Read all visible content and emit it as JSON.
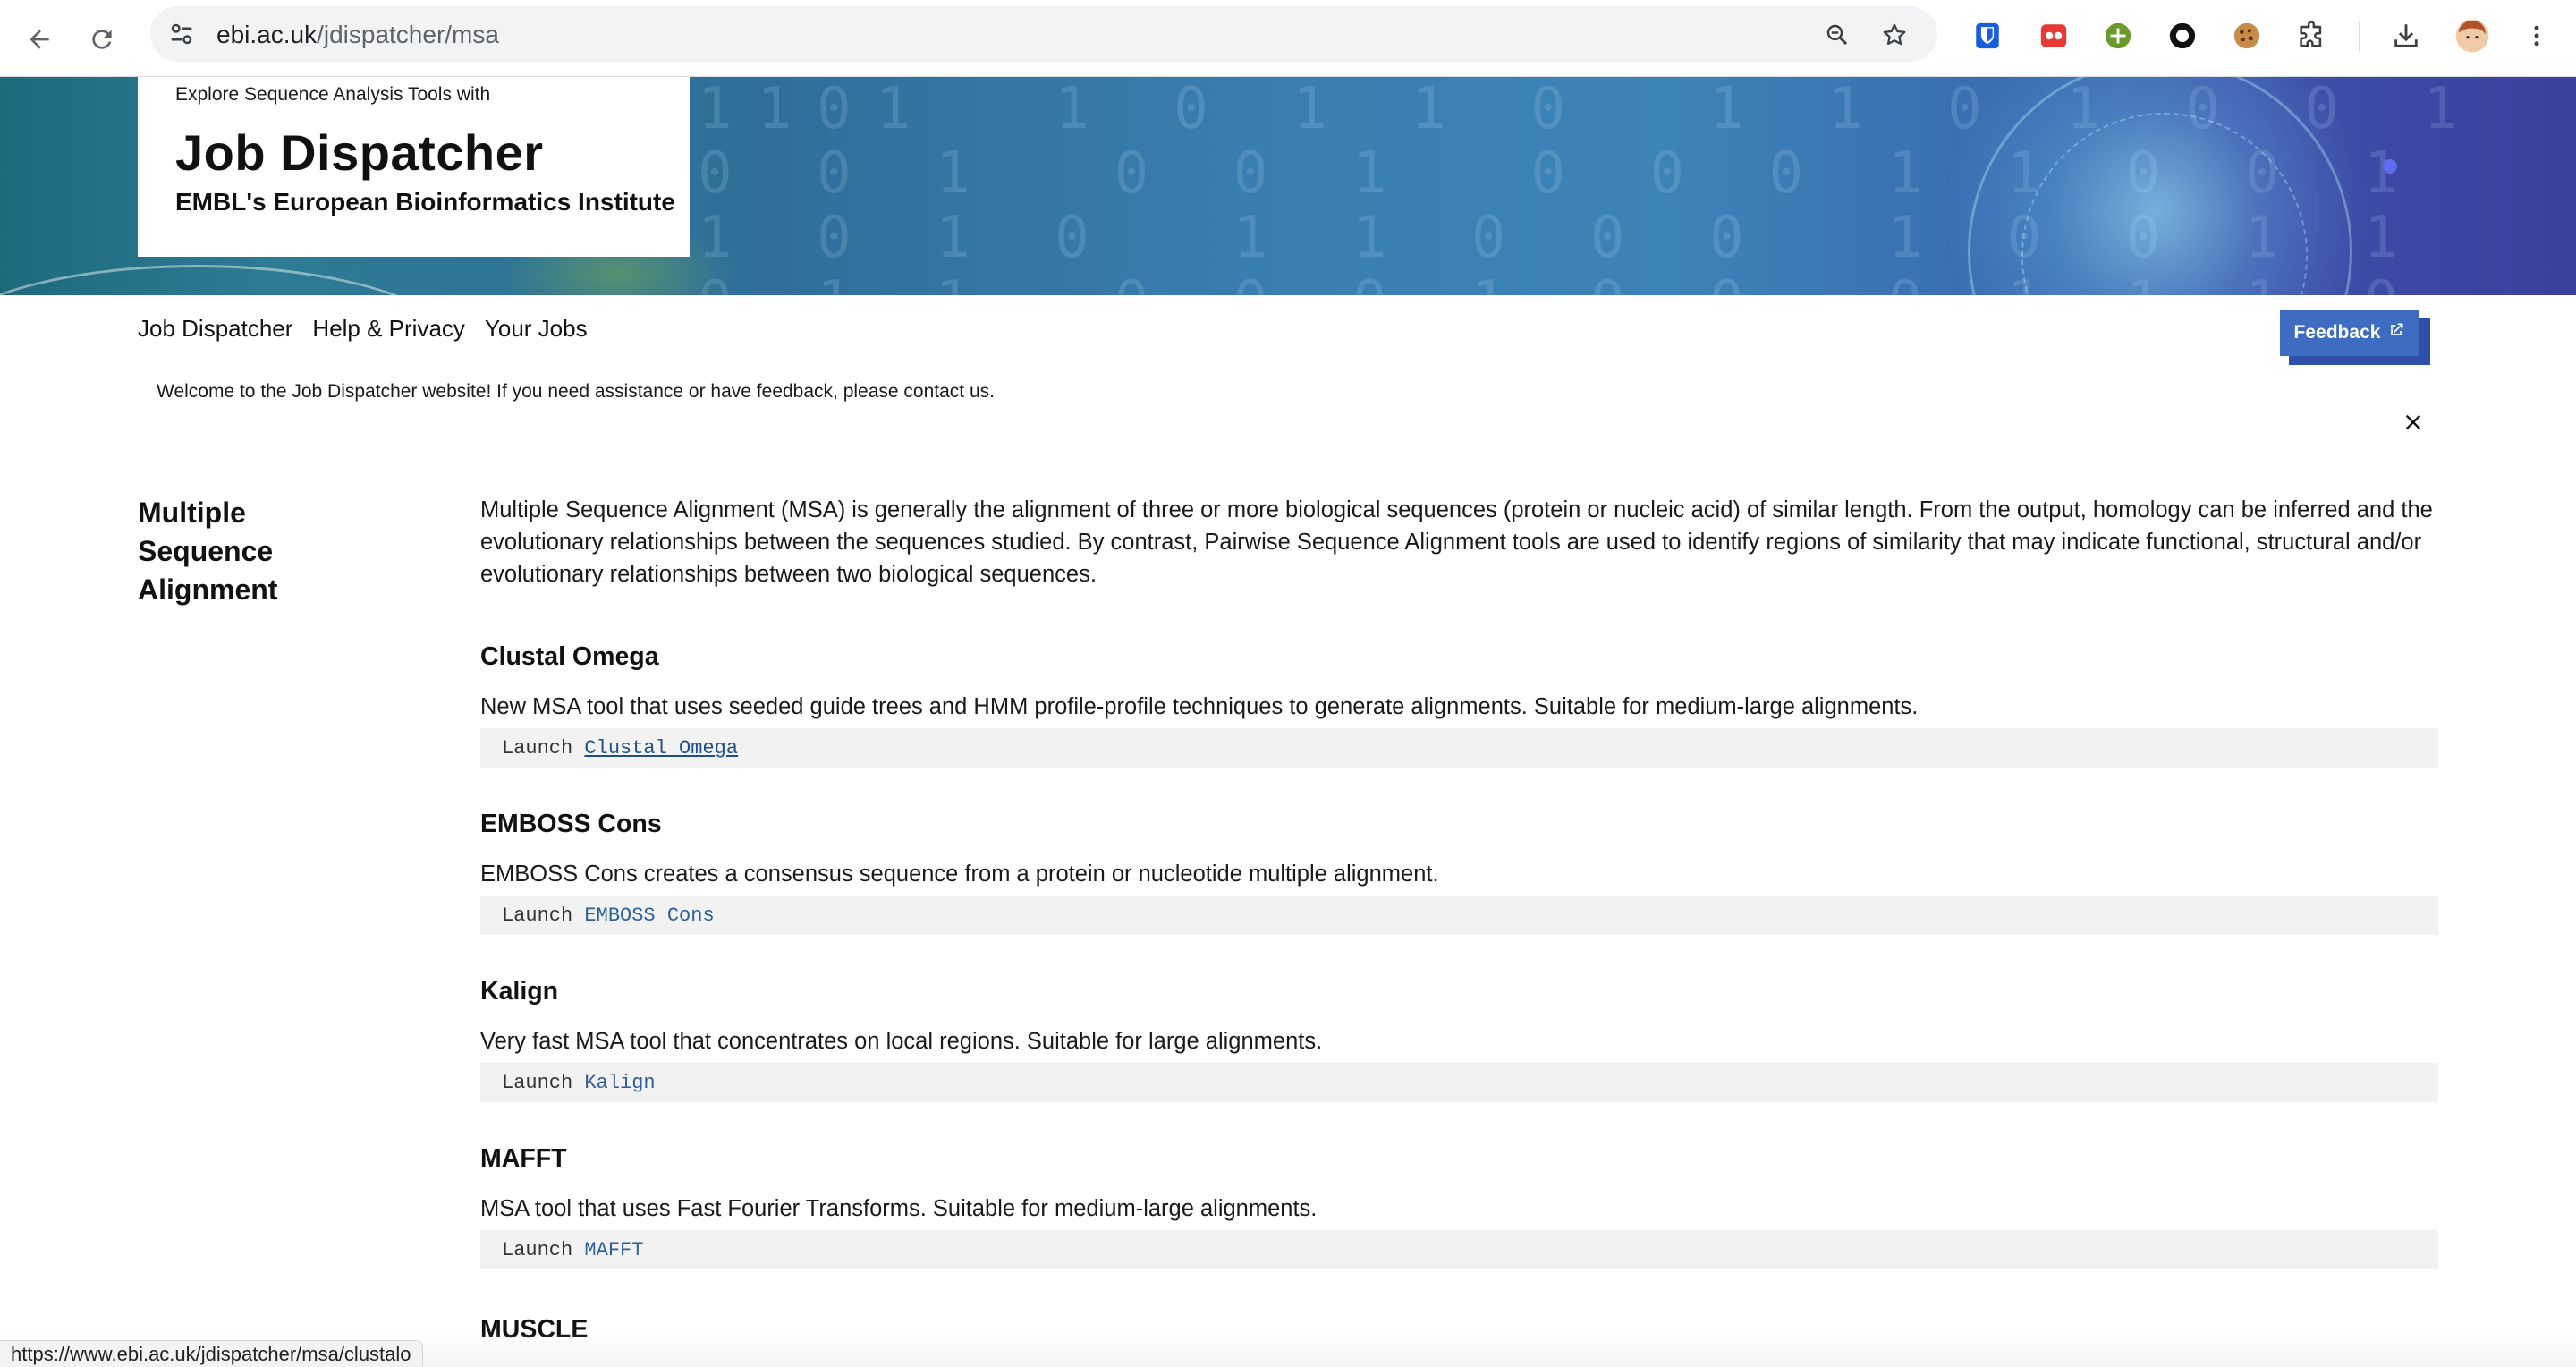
{
  "browser": {
    "url_host": "ebi.ac.uk",
    "url_path": "/jdispatcher/msa",
    "status_url": "https://www.ebi.ac.uk/jdispatcher/msa/clustalo",
    "icons": [
      "back-icon",
      "reload-icon",
      "site-info-icon",
      "zoom-icon",
      "star-icon",
      "bitwarden-icon",
      "ublock-icon",
      "add-extension-icon",
      "circle-extension-icon",
      "cookie-icon",
      "extensions-puzzle-icon",
      "download-icon",
      "profile-avatar",
      "menu-dots-icon"
    ]
  },
  "hero": {
    "kicker": "Explore Sequence Analysis Tools with",
    "title": "Job Dispatcher",
    "subtitle": "EMBL's European Bioinformatics Institute",
    "digits_art": "1101  1 0 1 1 0  1 1 0 1 0 0 1\n0 0 1  0 0 1  0 0 0 1 1 0 0 1\n1 0 1 0  1 1 0 0 0  1 0 0 1 1\n0 1 1  0 0 0 1 0 0  0 1 1 1 0"
  },
  "nav": {
    "items": [
      "Job Dispatcher",
      "Help & Privacy",
      "Your Jobs"
    ],
    "feedback_label": "Feedback"
  },
  "welcome": "Welcome to the Job Dispatcher website! If you need assistance or have feedback, please contact us.",
  "page": {
    "side_title": "Multiple Sequence Alignment",
    "intro": "Multiple Sequence Alignment (MSA) is generally the alignment of three or more biological sequences (protein or nucleic acid) of similar length. From the output, homology can be inferred and the evolutionary relationships between the sequences studied. By contrast, Pairwise Sequence Alignment tools are used to identify regions of similarity that may indicate functional, structural and/or evolutionary relationships between two biological sequences."
  },
  "launch_prefix": "Launch ",
  "tools": [
    {
      "name": "Clustal Omega",
      "desc": "New MSA tool that uses seeded guide trees and HMM profile-profile techniques to generate alignments. Suitable for medium-large alignments.",
      "link": "Clustal Omega"
    },
    {
      "name": "EMBOSS Cons",
      "desc": "EMBOSS Cons creates a consensus sequence from a protein or nucleotide multiple alignment.",
      "link": "EMBOSS Cons"
    },
    {
      "name": "Kalign",
      "desc": "Very fast MSA tool that concentrates on local regions. Suitable for large alignments.",
      "link": "Kalign"
    },
    {
      "name": "MAFFT",
      "desc": "MSA tool that uses Fast Fourier Transforms. Suitable for medium-large alignments.",
      "link": "MAFFT"
    },
    {
      "name": "MUSCLE"
    }
  ],
  "colors": {
    "feedback_bg": "#3d6cc0",
    "link": "#2f5f9a",
    "launch_bg": "#f2f2f2"
  }
}
